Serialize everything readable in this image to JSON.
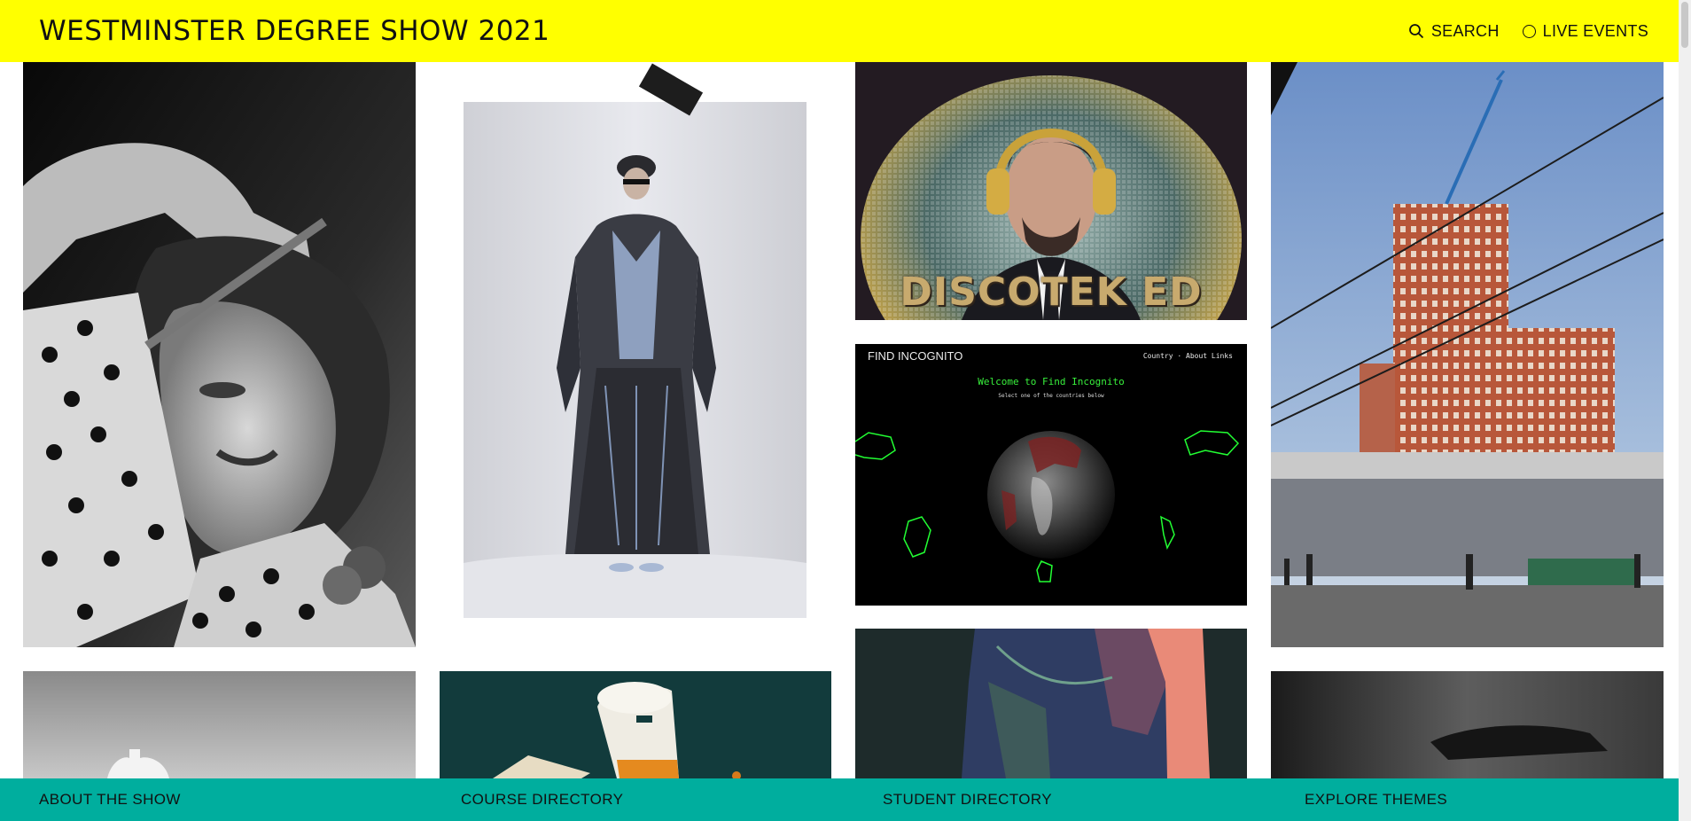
{
  "header": {
    "title": "WESTMINSTER DEGREE SHOW 2021",
    "search_label": "SEARCH",
    "live_label": "LIVE EVENTS",
    "icons": {
      "search": "search-icon",
      "live": "circle-icon"
    }
  },
  "tiles": {
    "discotek": {
      "text": "DISCOTEK ED"
    },
    "incognito": {
      "title": "FIND INCOGNITO",
      "nav": "Country · About Links",
      "welcome": "Welcome to Find Incognito",
      "subtitle": "Select one of the countries below"
    }
  },
  "footer": {
    "items": [
      "ABOUT THE SHOW",
      "COURSE DIRECTORY",
      "STUDENT DIRECTORY",
      "EXPLORE THEMES"
    ]
  },
  "colors": {
    "header_bg": "#ffff00",
    "footer_bg": "#00ae9e"
  }
}
